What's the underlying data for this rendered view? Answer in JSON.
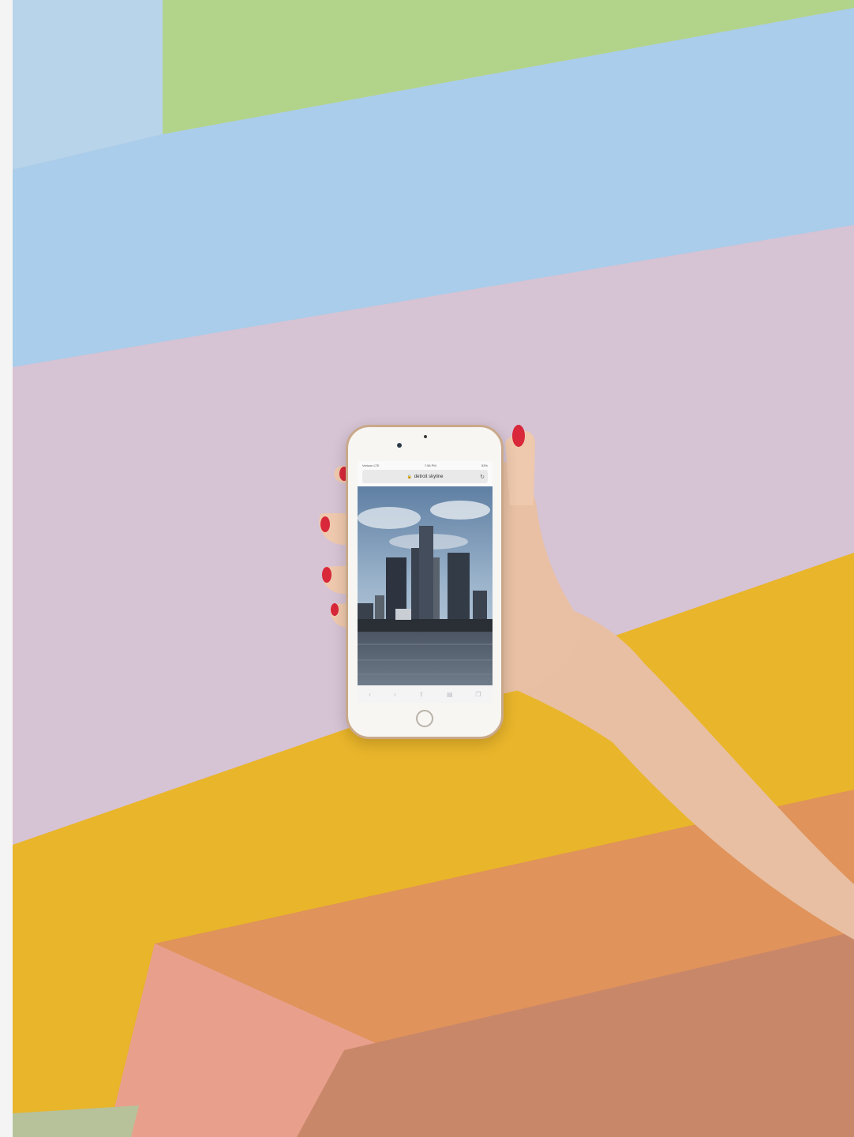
{
  "photo": {
    "subject": "hand-holding-phone",
    "wall_colors": {
      "green": "#b2d48a",
      "blue": "#a9cdea",
      "lilac": "#d6c3d4",
      "yellow": "#e9b52a",
      "orange": "#e0935a",
      "salmon": "#e8a08c"
    },
    "nail_color": "#d8283a"
  },
  "phone": {
    "status_carrier": "Verizon LTE",
    "status_time": "7:56 PM",
    "status_battery": "53%",
    "url_text": "detroit skyline",
    "lock_icon": "lock-icon",
    "reload_icon": "reload-icon",
    "toolbar_icons": [
      "back-icon",
      "forward-icon",
      "share-icon",
      "bookmarks-icon",
      "tabs-icon"
    ]
  }
}
